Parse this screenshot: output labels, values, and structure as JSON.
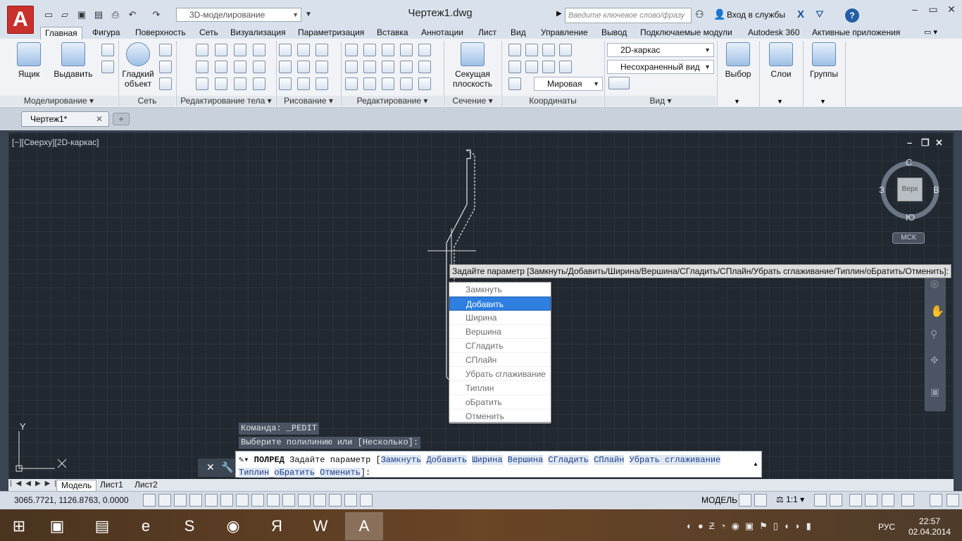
{
  "app": {
    "logo_letter": "A",
    "logo_icon": "autocad-logo-icon"
  },
  "quick_access": {
    "workspace": "3D-моделирование",
    "doc_title": "Чертеж1.dwg"
  },
  "search": {
    "placeholder": "Введите ключевое слово/фразу"
  },
  "login": {
    "label": "Вход в службы"
  },
  "ribbon_tabs": [
    "Главная",
    "Фигура",
    "Поверхность",
    "Сеть",
    "Визуализация",
    "Параметризация",
    "Вставка",
    "Аннотации",
    "Лист",
    "Вид",
    "Управление",
    "Вывод",
    "Подключаемые модули",
    "Autodesk 360",
    "Активные приложения"
  ],
  "ribbon": {
    "box": "Ящик",
    "extrude": "Выдавить",
    "smooth": "Гладкий",
    "smooth2": "объект",
    "section_plane": "Секущая",
    "section_plane2": "плоскость",
    "visual_style": "2D-каркас",
    "view_saved": "Несохраненный вид",
    "coord_world": "Мировая",
    "select": "Выбор",
    "layers": "Слои",
    "groups": "Группы",
    "panels": {
      "modeling": "Моделирование",
      "mesh": "Сеть",
      "solid_edit": "Редактирование тела",
      "draw": "Рисование",
      "edit": "Редактирование",
      "section": "Сечение",
      "coords": "Координаты",
      "view": "Вид"
    }
  },
  "document_tab": "Чертеж1*",
  "viewport": {
    "label": "[−][Сверху][2D-каркас]",
    "viewcube": {
      "north": "С",
      "south": "Ю",
      "west": "З",
      "east": "В",
      "face": "Верх",
      "ucs": "МСК"
    }
  },
  "prompt_tip": "Задайте параметр [Замкнуть/Добавить/Ширина/Вершина/СГладить/СПлайн/Убрать сглаживание/Типлин/оБратить/Отменить]:",
  "menu": {
    "items": [
      "Замкнуть",
      "Добавить",
      "Ширина",
      "Вершина",
      "СГладить",
      "СПлайн",
      "Убрать сглаживание",
      "Типлин",
      "оБратить",
      "Отменить"
    ],
    "selected_index": 1
  },
  "command_history": [
    "Команда: _PEDIT",
    "Выберите полилинию или [Несколько]:"
  ],
  "command_line": {
    "name": "ПОЛРЕД",
    "text": "Задайте параметр",
    "options": [
      "Замкнуть",
      "Добавить",
      "Ширина",
      "Вершина",
      "СГладить",
      "СПлайн",
      "Убрать сглаживание",
      "Типлин",
      "оБратить",
      "Отменить"
    ],
    "end": "]:"
  },
  "layout_tabs": [
    "Модель",
    "Лист1",
    "Лист2"
  ],
  "status": {
    "coords": "3065.7721, 1126.8763, 0.0000",
    "model": "МОДЕЛЬ",
    "scale": "1:1"
  },
  "ucs_icon": {
    "y": "Y"
  },
  "tray": {
    "lang": "РУС",
    "time": "22:57",
    "date": "02.04.2014"
  },
  "taskbar_apps": [
    "windows-start-icon",
    "save-app-icon",
    "explorer-icon",
    "internet-explorer-icon",
    "skype-icon",
    "chrome-icon",
    "yandex-icon",
    "word-icon",
    "autocad-icon"
  ]
}
